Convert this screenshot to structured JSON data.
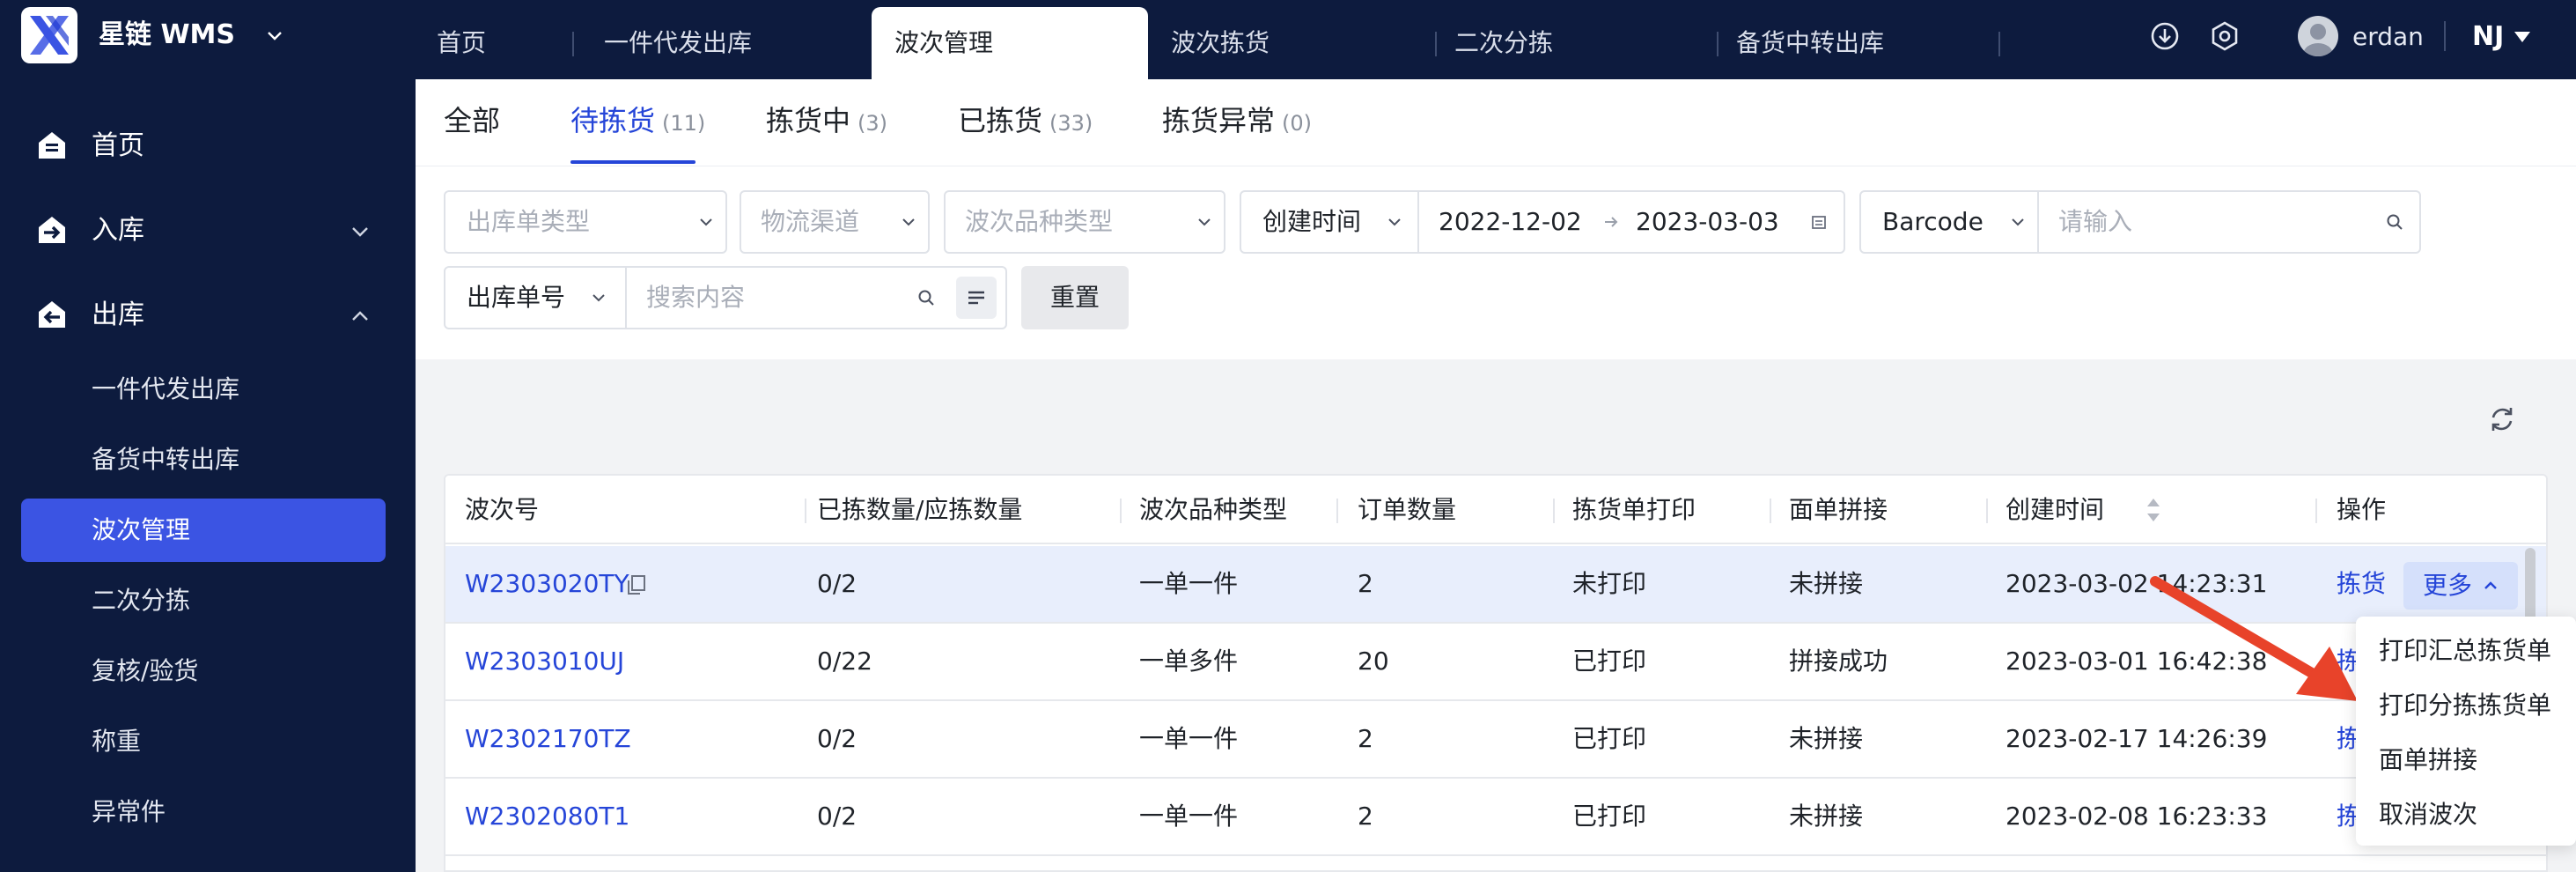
{
  "app": {
    "name": "星链  WMS",
    "user_name": "erdan",
    "org": "NJ",
    "colors": {
      "nav_bg": "#0d1b3e",
      "accent": "#3b54e3",
      "link": "#2545d8",
      "row_highlight": "#e8eefc",
      "annotation_arrow": "#e8432a"
    }
  },
  "top_tabs": [
    {
      "label": "首页"
    },
    {
      "label": "一件代发出库"
    },
    {
      "label": "波次管理"
    },
    {
      "label": "波次拣货"
    },
    {
      "label": "二次分拣"
    },
    {
      "label": "备货中转出库"
    }
  ],
  "header_icons": [
    "download-icon",
    "settings-icon",
    "avatar"
  ],
  "sidebar": {
    "groups": [
      {
        "label": "首页",
        "icon": "home-icon"
      },
      {
        "label": "入库",
        "icon": "inbound-icon"
      },
      {
        "label": "出库",
        "icon": "outbound-icon"
      }
    ],
    "items": [
      {
        "label": "一件代发出库"
      },
      {
        "label": "备货中转出库"
      },
      {
        "label": "波次管理"
      },
      {
        "label": "二次分拣"
      },
      {
        "label": "复核/验货"
      },
      {
        "label": "称重"
      },
      {
        "label": "异常件"
      }
    ]
  },
  "status_tabs": [
    {
      "label": "全部",
      "count": ""
    },
    {
      "label": "待拣货",
      "count": "(11)"
    },
    {
      "label": "拣货中",
      "count": "(3)"
    },
    {
      "label": "已拣货",
      "count": "(33)"
    },
    {
      "label": "拣货异常",
      "count": "(0)"
    }
  ],
  "filters": {
    "outbound_type_placeholder": "出库单类型",
    "logistics_placeholder": "物流渠道",
    "wave_type_placeholder": "波次品种类型",
    "date_field": "创建时间",
    "date_start": "2022-12-02",
    "date_end": "2023-03-03",
    "code_field": "Barcode",
    "code_placeholder": "请输入",
    "order_field": "出库单号",
    "search_placeholder": "搜索内容",
    "reset_label": "重置"
  },
  "table": {
    "columns": [
      "波次号",
      "已拣数量/应拣数量",
      "波次品种类型",
      "订单数量",
      "拣货单打印",
      "面单拼接",
      "创建时间",
      "操作"
    ],
    "rows": [
      {
        "wave_no": "W2303020TY",
        "picked": "0/2",
        "type": "一单一件",
        "orders": "2",
        "print": "未打印",
        "join": "未拼接",
        "created": "2023-03-02 14:23:31",
        "action": "拣货"
      },
      {
        "wave_no": "W2303010UJ",
        "picked": "0/22",
        "type": "一单多件",
        "orders": "20",
        "print": "已打印",
        "join": "拼接成功",
        "created": "2023-03-01 16:42:38",
        "action": "拣货"
      },
      {
        "wave_no": "W2302170TZ",
        "picked": "0/2",
        "type": "一单一件",
        "orders": "2",
        "print": "已打印",
        "join": "未拼接",
        "created": "2023-02-17 14:26:39",
        "action": "拣货"
      },
      {
        "wave_no": "W2302080T1",
        "picked": "0/2",
        "type": "一单一件",
        "orders": "2",
        "print": "已打印",
        "join": "未拼接",
        "created": "2023-02-08 16:23:33",
        "action": "拣货"
      }
    ],
    "more_label": "更多"
  },
  "more_menu": [
    {
      "label": "打印汇总拣货单"
    },
    {
      "label": "打印分拣拣货单"
    },
    {
      "label": "面单拼接"
    },
    {
      "label": "取消波次"
    }
  ]
}
